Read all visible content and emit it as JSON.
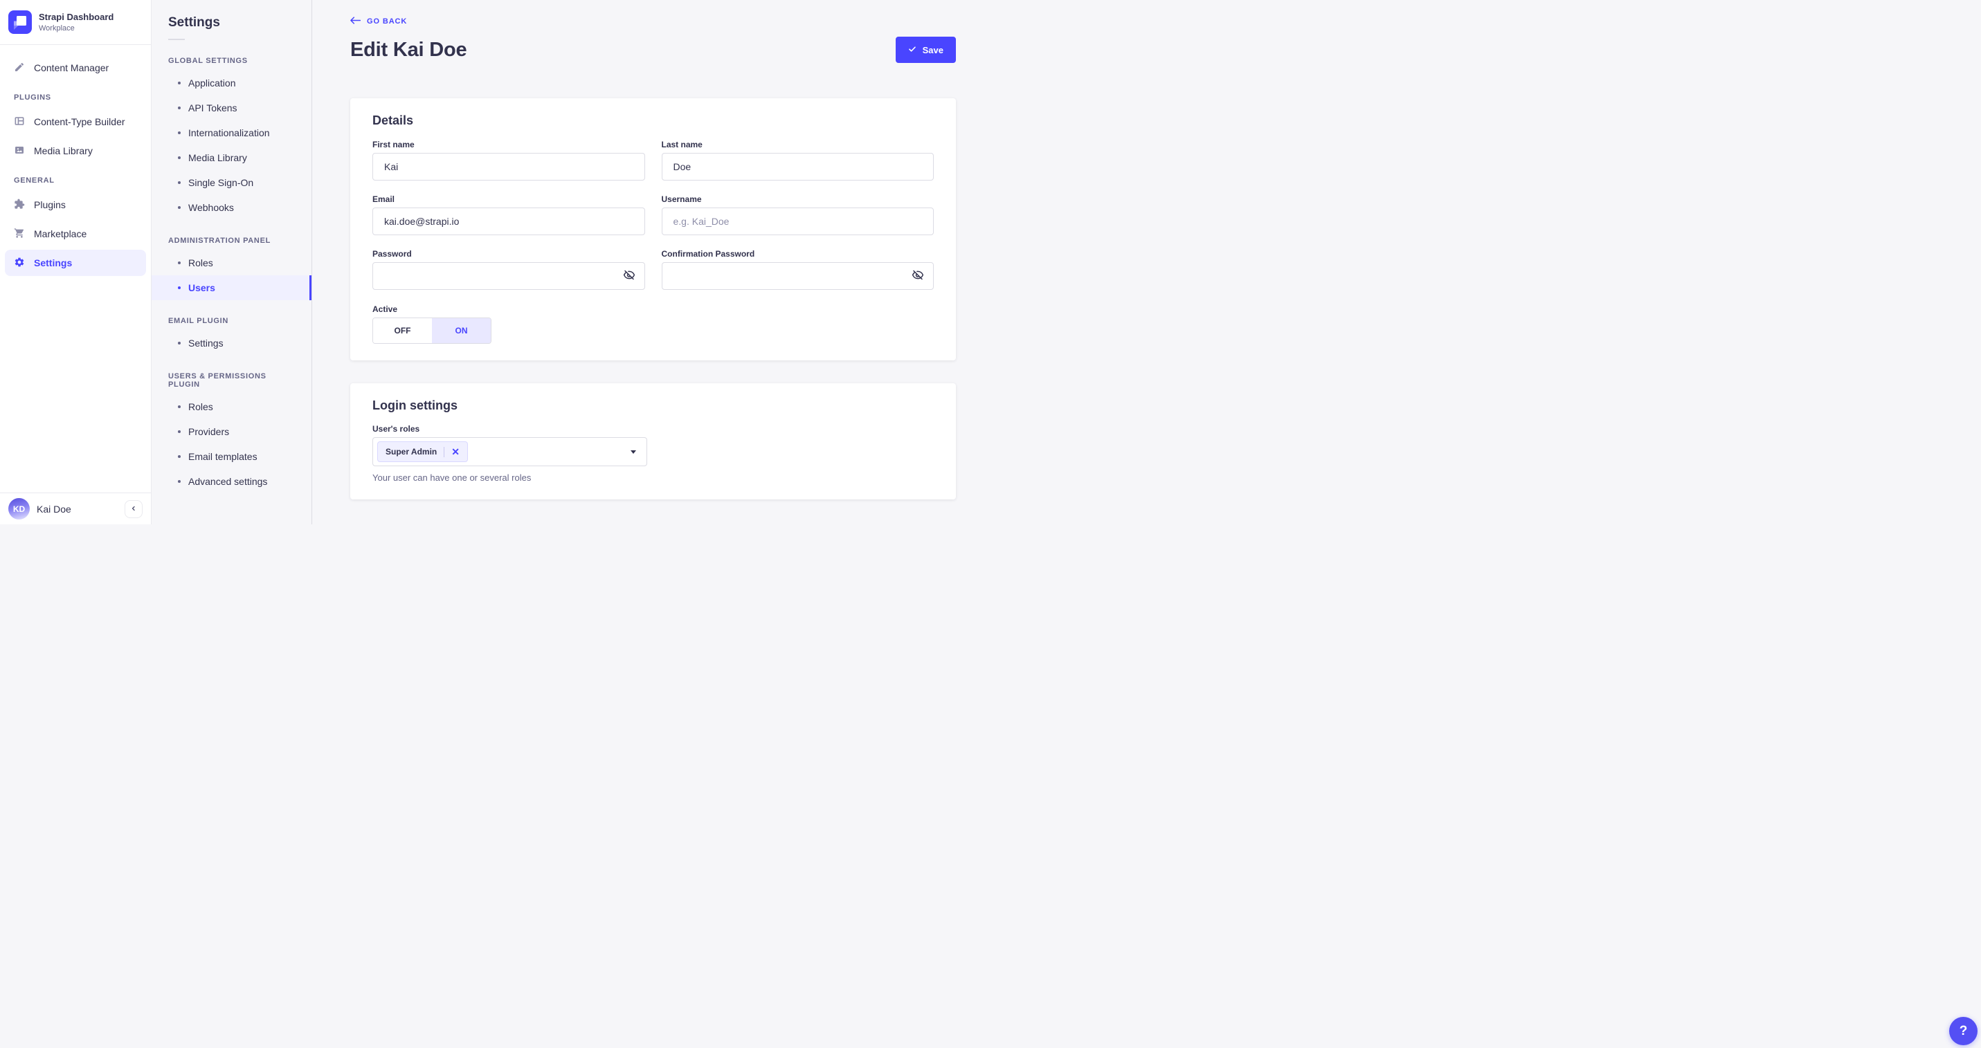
{
  "nav": {
    "brand": {
      "title": "Strapi Dashboard",
      "subtitle": "Workplace"
    },
    "content_manager": {
      "label": "Content Manager",
      "icon": "feather-icon"
    },
    "sections": [
      {
        "header": "PLUGINS",
        "items": [
          {
            "label": "Content-Type Builder",
            "icon": "layout-icon"
          },
          {
            "label": "Media Library",
            "icon": "image-icon"
          }
        ]
      },
      {
        "header": "GENERAL",
        "items": [
          {
            "label": "Plugins",
            "icon": "puzzle-icon"
          },
          {
            "label": "Marketplace",
            "icon": "cart-icon"
          },
          {
            "label": "Settings",
            "icon": "gear-icon",
            "active": true
          }
        ]
      }
    ],
    "user": {
      "name": "Kai Doe",
      "initials": "KD"
    }
  },
  "subnav": {
    "title": "Settings",
    "sections": [
      {
        "header": "GLOBAL SETTINGS",
        "items": [
          "Application",
          "API Tokens",
          "Internationalization",
          "Media Library",
          "Single Sign-On",
          "Webhooks"
        ]
      },
      {
        "header": "ADMINISTRATION PANEL",
        "items": [
          "Roles",
          "Users"
        ],
        "active_item": "Users"
      },
      {
        "header": "EMAIL PLUGIN",
        "items": [
          "Settings"
        ]
      },
      {
        "header": "USERS & PERMISSIONS PLUGIN",
        "items": [
          "Roles",
          "Providers",
          "Email templates",
          "Advanced settings"
        ]
      }
    ]
  },
  "header": {
    "back_label": "GO BACK",
    "title": "Edit Kai Doe",
    "save_label": "Save"
  },
  "details": {
    "heading": "Details",
    "fields": [
      {
        "label": "First name",
        "value": "Kai"
      },
      {
        "label": "Last name",
        "value": "Doe"
      },
      {
        "label": "Email",
        "value": "kai.doe@strapi.io"
      },
      {
        "label": "Username",
        "placeholder": "e.g. Kai_Doe"
      },
      {
        "label": "Password"
      },
      {
        "label": "Confirmation Password"
      }
    ],
    "active_toggle": {
      "label": "Active",
      "off_label": "OFF",
      "on_label": "ON",
      "selected": "ON"
    }
  },
  "login_settings": {
    "heading": "Login settings",
    "roles_label": "User's roles",
    "selected_role": "Super Admin",
    "remove_label": "✕",
    "helper": "Your user can have one or several roles"
  },
  "help_button": {
    "label": "?"
  },
  "colors": {
    "primary": "#4945ff",
    "primary_light_bg": "#f0f0ff",
    "toggle_on_bg": "#e9e8ff",
    "text": "#32324d",
    "text_muted": "#666687",
    "placeholder": "#8e8ea9",
    "input_border": "#dcdce4",
    "nav_border": "#eaeaef",
    "app_bg": "#f6f6f9",
    "surface": "#ffffff",
    "tag_border": "#d9d8ff"
  }
}
